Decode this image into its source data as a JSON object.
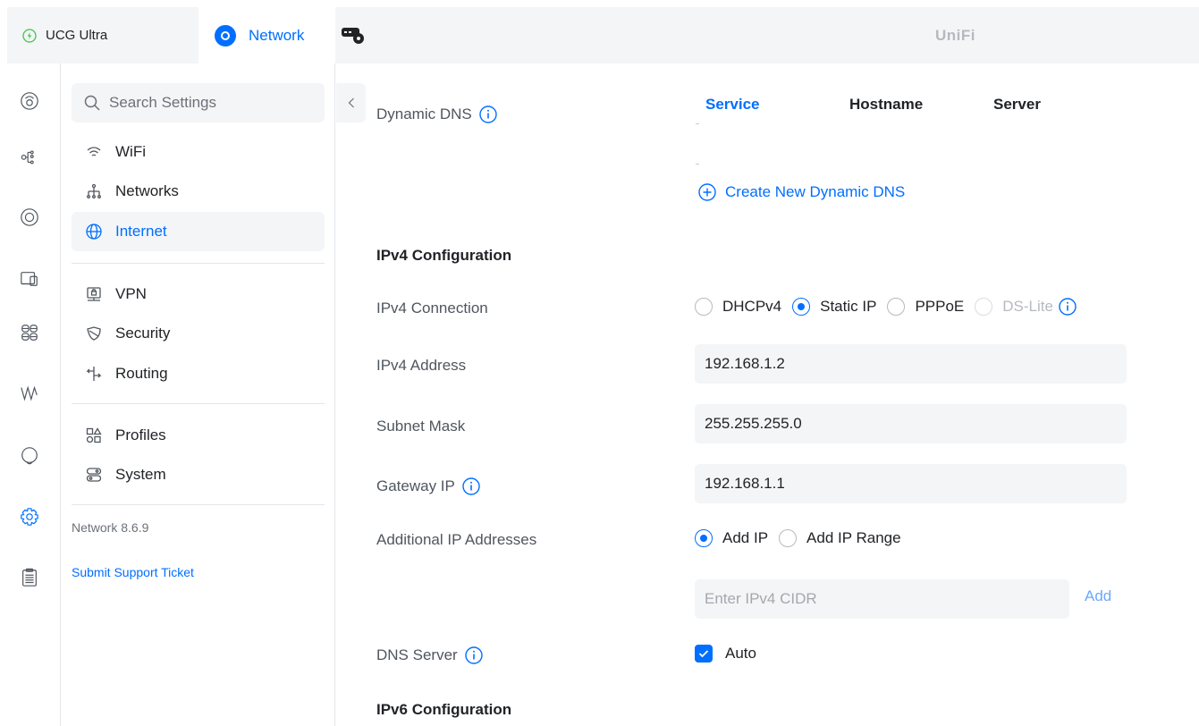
{
  "topbar": {
    "console_tab": "UCG Ultra",
    "app_tab": "Network",
    "brand": "UniFi"
  },
  "sidebar": {
    "search_placeholder": "Search Settings",
    "items": [
      {
        "label": "WiFi",
        "icon": "wifi-icon"
      },
      {
        "label": "Networks",
        "icon": "networks-icon"
      },
      {
        "label": "Internet",
        "icon": "globe-icon",
        "active": true
      },
      {
        "label": "VPN",
        "icon": "vpn-icon"
      },
      {
        "label": "Security",
        "icon": "shield-icon"
      },
      {
        "label": "Routing",
        "icon": "routing-icon"
      },
      {
        "label": "Profiles",
        "icon": "profiles-icon"
      },
      {
        "label": "System",
        "icon": "system-icon"
      }
    ],
    "version": "Network 8.6.9",
    "support_link": "Submit Support Ticket"
  },
  "main": {
    "dynamic_dns": {
      "label": "Dynamic DNS",
      "columns": [
        "Service",
        "Hostname",
        "Server"
      ],
      "create_link": "Create New Dynamic DNS"
    },
    "ipv4": {
      "heading": "IPv4 Configuration",
      "connection_label": "IPv4 Connection",
      "connection_options": [
        "DHCPv4",
        "Static IP",
        "PPPoE",
        "DS-Lite"
      ],
      "connection_selected": "Static IP",
      "address_label": "IPv4 Address",
      "address_value": "192.168.1.2",
      "subnet_label": "Subnet Mask",
      "subnet_value": "255.255.255.0",
      "gateway_label": "Gateway IP",
      "gateway_value": "192.168.1.1",
      "additional_label": "Additional IP Addresses",
      "additional_options": [
        "Add IP",
        "Add IP Range"
      ],
      "additional_selected": "Add IP",
      "cidr_placeholder": "Enter IPv4 CIDR",
      "add_button": "Add",
      "dns_label": "DNS Server",
      "dns_auto_label": "Auto",
      "dns_auto_checked": true
    },
    "ipv6": {
      "heading": "IPv6 Configuration"
    }
  },
  "colors": {
    "accent": "#006fff",
    "text": "#212327",
    "muted": "#50565e",
    "panel": "#f4f5f6",
    "status_green": "#3ec44a"
  }
}
